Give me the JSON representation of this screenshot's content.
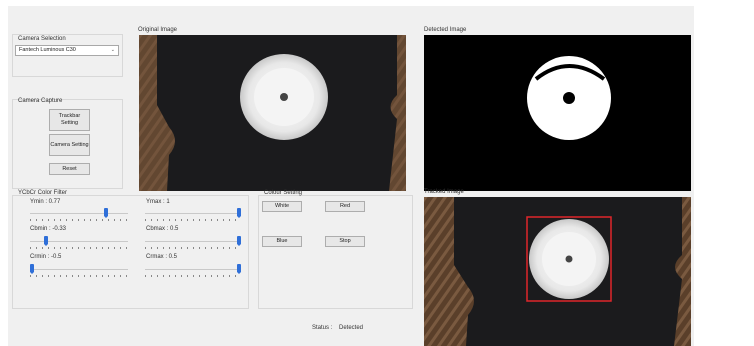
{
  "camera_selection": {
    "title": "Camera Selection",
    "selected": "Fantech Luminous C30"
  },
  "camera_capture": {
    "title": "Camera Capture",
    "trackbar_btn": "Trackbar Setting",
    "camera_btn": "Camera Setting",
    "reset_btn": "Reset"
  },
  "filter": {
    "title": "YCbCr Color Filter",
    "sliders": [
      {
        "label": "Ymin : 0.77",
        "fraction": 0.79
      },
      {
        "label": "Ymax : 1",
        "fraction": 1.0
      },
      {
        "label": "Cbmin : -0.33",
        "fraction": 0.15
      },
      {
        "label": "Cbmax : 0.5",
        "fraction": 1.0
      },
      {
        "label": "Crmin : -0.5",
        "fraction": 0.0
      },
      {
        "label": "Crmax : 0.5",
        "fraction": 1.0
      }
    ]
  },
  "colour_setting": {
    "title": "Colour Setting",
    "white_btn": "White",
    "red_btn": "Red",
    "blue_btn": "Blue",
    "stop_btn": "Stop"
  },
  "images": {
    "original": "Original Image",
    "detected": "Detected Image",
    "tracked": "Tracked Image"
  },
  "status": {
    "label": "Status :",
    "value": "Detected"
  },
  "colors": {
    "slider_thumb": "#2f6fd8",
    "tracking_box": "#e0262b"
  }
}
